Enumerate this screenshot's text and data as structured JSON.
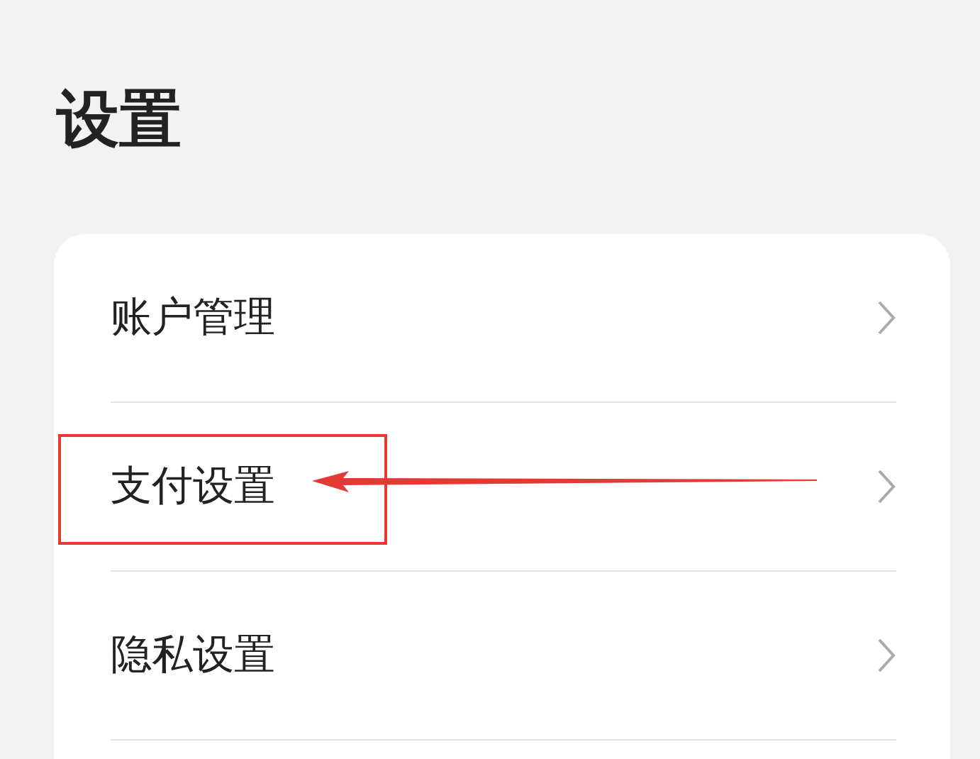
{
  "title": "设置",
  "items": [
    {
      "label": "账户管理",
      "highlighted": false
    },
    {
      "label": "支付设置",
      "highlighted": true
    },
    {
      "label": "隐私设置",
      "highlighted": false
    }
  ]
}
